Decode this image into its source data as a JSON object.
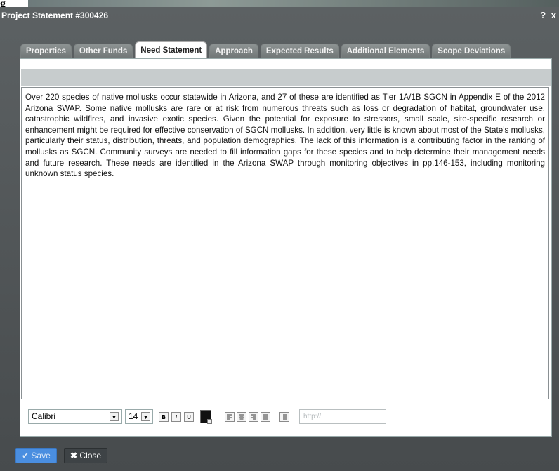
{
  "dialog": {
    "title": "Project Statement #300426",
    "help_icon": "?",
    "close_icon": "x"
  },
  "tabs": [
    {
      "label": "Properties"
    },
    {
      "label": "Other Funds"
    },
    {
      "label": "Need Statement"
    },
    {
      "label": "Approach"
    },
    {
      "label": "Expected Results"
    },
    {
      "label": "Additional Elements"
    },
    {
      "label": "Scope Deviations"
    }
  ],
  "editor": {
    "text": "Over 220 species of native mollusks occur statewide in Arizona, and 27 of these are identified as Tier 1A/1B SGCN in Appendix E of the 2012 Arizona SWAP. Some native mollusks are rare or at risk from numerous threats such as loss or degradation of habitat, groundwater use, catastrophic wildfires, and invasive exotic species. Given the potential for exposure to stressors, small scale, site-specific research or enhancement might be required for effective conservation of SGCN mollusks. In addition, very little is known about most of the State’s mollusks, particularly their status, distribution, threats, and population demographics. The lack of this information is a contributing factor in the ranking of mollusks as SGCN. Community surveys are needed to fill information gaps for these species and to help determine their management needs and future research. These needs are identified in the Arizona SWAP through monitoring objectives in pp.146-153, including monitoring unknown status species."
  },
  "toolbar": {
    "font_family": "Calibri",
    "font_size": "14",
    "bold": "B",
    "italic": "I",
    "underline": "U",
    "link_placeholder": "http://"
  },
  "footer": {
    "save_label": "Save",
    "close_label": "Close"
  },
  "background": {
    "fragment": "g"
  },
  "colors": {
    "accent": "#4a8ee0",
    "dialog_bg": "#4b4f51"
  }
}
